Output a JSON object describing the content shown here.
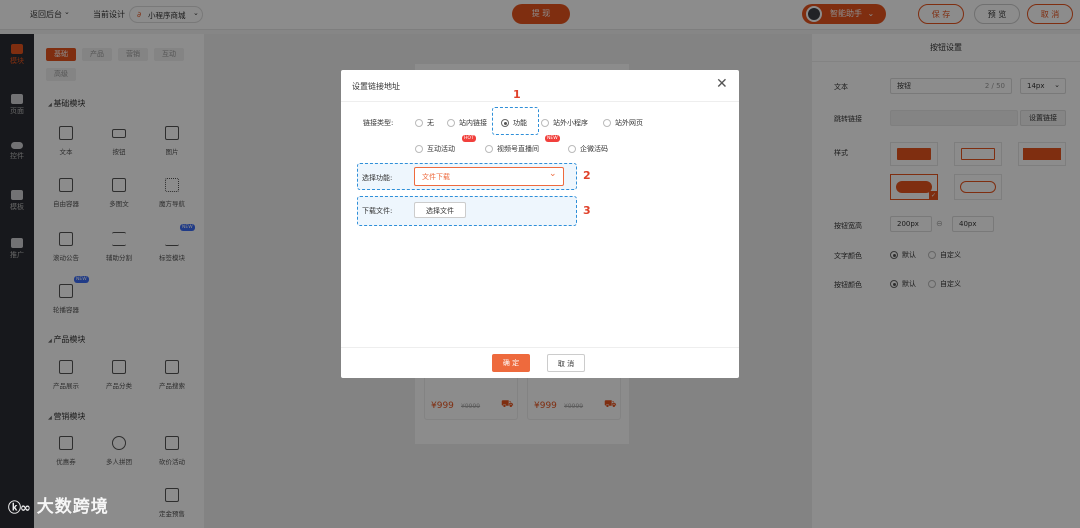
{
  "topbar": {
    "back_label": "返回后台",
    "current_design_label": "当前设计",
    "design_select_value": "小程序商城",
    "submit_label": "提 现",
    "assistant_label": "智能助手",
    "save_label": "保 存",
    "preview_label": "预 览",
    "cancel_label": "取 消"
  },
  "leftrail": {
    "items": [
      {
        "label": "模块"
      },
      {
        "label": "页面"
      },
      {
        "label": "控件"
      },
      {
        "label": "模板"
      },
      {
        "label": "推广"
      }
    ]
  },
  "leftpanel": {
    "tabs": [
      "基础",
      "产品",
      "营销",
      "互动",
      "高级"
    ],
    "sections": [
      {
        "title": "基础模块",
        "items": [
          "文本",
          "按钮",
          "图片",
          "自由容器",
          "多图文",
          "魔方导航",
          "滚动公告",
          "辅助分割",
          "标签模块",
          "轮播容器"
        ]
      },
      {
        "title": "产品模块",
        "items": [
          "产品展示",
          "产品分类",
          "产品搜索"
        ]
      },
      {
        "title": "营销模块",
        "items": [
          "优惠券",
          "多人拼团",
          "砍价活动",
          "定金预售"
        ]
      }
    ],
    "new_badge": "NEW"
  },
  "canvas": {
    "prices": [
      {
        "price": "¥999",
        "old": "¥9999"
      },
      {
        "price": "¥999",
        "old": "¥9999"
      }
    ]
  },
  "rightpanel": {
    "title": "按钮设置",
    "text_label": "文本",
    "text_value": "按钮",
    "text_count": "2 / 50",
    "font_size": "14px",
    "link_label": "跳转链接",
    "link_button": "设置链接",
    "style_label": "样式",
    "size_label": "按钮宽高",
    "width_value": "200px",
    "height_value": "40px",
    "text_color_label": "文字颜色",
    "button_color_label": "按钮颜色",
    "default_option": "默认",
    "custom_option": "自定义"
  },
  "dialog": {
    "title": "设置链接地址",
    "link_type_label": "链接类型:",
    "link_types": [
      "无",
      "站内链接",
      "功能",
      "站外小程序",
      "站外网页",
      "互动活动",
      "视频号直播间",
      "企微活码"
    ],
    "hot_badge": "HOT",
    "new_badge": "NEW",
    "function_label": "选择功能:",
    "function_value": "文件下载",
    "download_label": "下载文件:",
    "choose_file_button": "选择文件",
    "confirm_label": "确 定",
    "cancel_label": "取 消",
    "markers": [
      "1",
      "2",
      "3"
    ]
  },
  "watermark": {
    "text": "大数跨境"
  },
  "colors": {
    "accent": "#ee6a3d",
    "brand_orange": "#e8541e",
    "annotation_blue": "#2f8fd8",
    "annotation_red": "#e0412a"
  }
}
